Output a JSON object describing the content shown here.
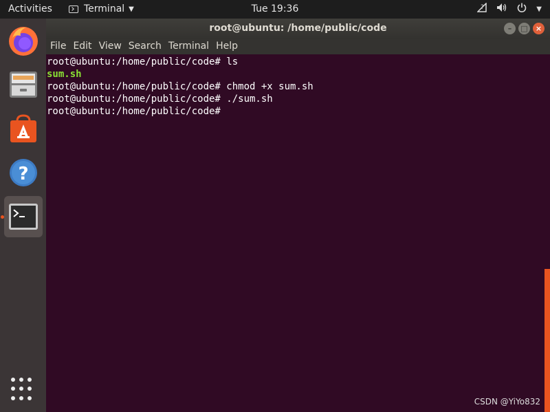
{
  "topbar": {
    "activities": "Activities",
    "app_name": "Terminal",
    "clock": "Tue 19:36"
  },
  "window": {
    "title": "root@ubuntu: /home/public/code",
    "menu": [
      "File",
      "Edit",
      "View",
      "Search",
      "Terminal",
      "Help"
    ]
  },
  "terminal": {
    "lines": [
      {
        "text": "root@ubuntu:/home/public/code# ls"
      },
      {
        "text": "sum.sh"
      },
      {
        "text": "root@ubuntu:/home/public/code# chmod +x sum.sh"
      },
      {
        "text": "root@ubuntu:/home/public/code# ./sum.sh"
      },
      {
        "text": "root@ubuntu:/home/public/code#"
      }
    ]
  },
  "watermark": "CSDN @YiYo832",
  "colors": {
    "terminal_bg": "#300a24",
    "accent": "#e95420",
    "exec_green": "#8ae234"
  },
  "dock": [
    "firefox-icon",
    "files-icon",
    "software-icon",
    "help-icon",
    "terminal-icon"
  ]
}
